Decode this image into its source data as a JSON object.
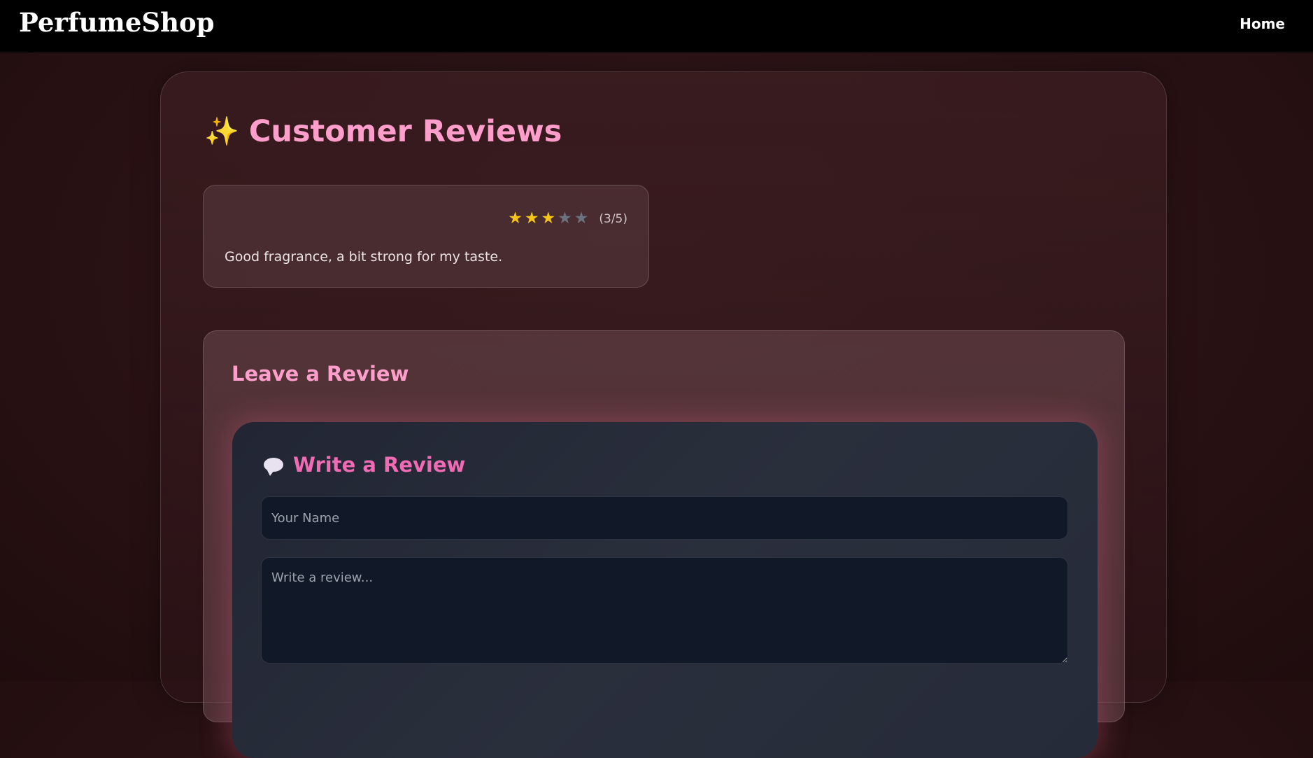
{
  "header": {
    "brand": "PerfumeShop",
    "nav_home": "Home"
  },
  "reviews": {
    "title": "Customer Reviews",
    "title_icon": "sparkles-icon",
    "items": [
      {
        "rating": 3,
        "max_rating": 5,
        "rating_text": "(3/5)",
        "text": "Good fragrance, a bit strong for my taste."
      }
    ]
  },
  "leave_review": {
    "title": "Leave a Review",
    "form": {
      "title": "Write a Review",
      "title_icon": "speech-bubble-icon",
      "name_placeholder": "Your Name",
      "review_placeholder": "Write a review..."
    }
  },
  "colors": {
    "accent_pink": "#ff9ecb",
    "form_title_pink": "#f06bb4",
    "star_filled": "#f5c518",
    "star_empty": "#6b7280"
  }
}
